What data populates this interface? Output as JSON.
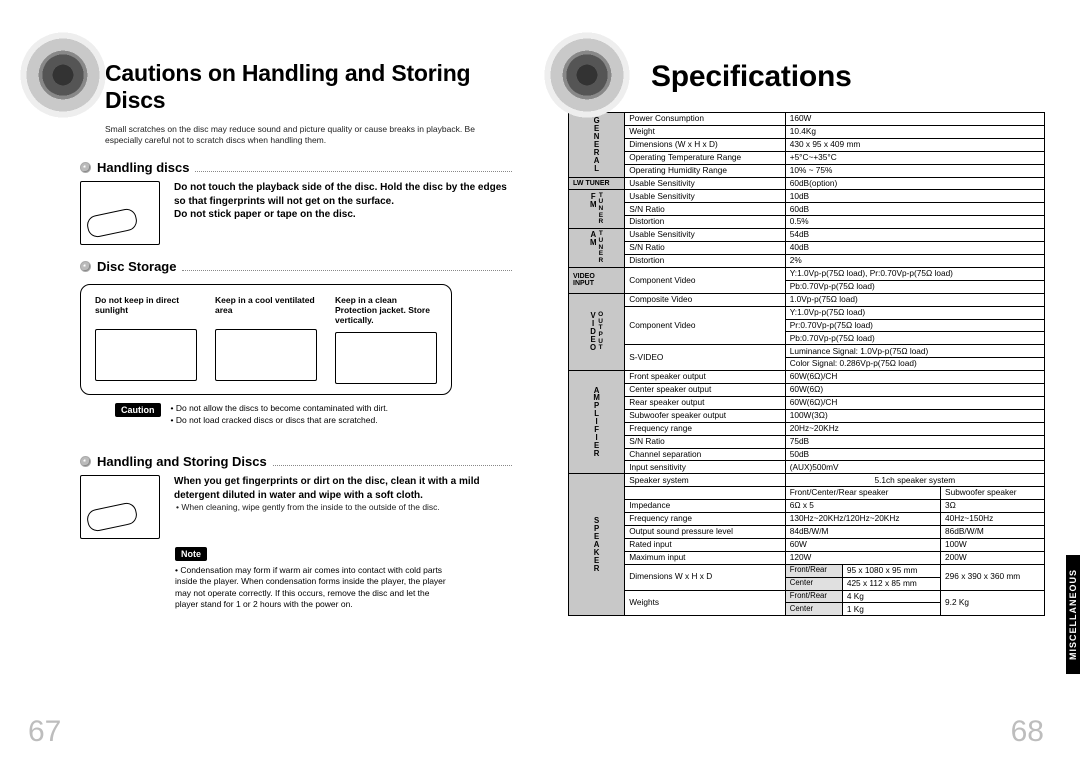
{
  "left": {
    "title": "Cautions on Handling and Storing Discs",
    "intro": "Small scratches on the disc may reduce sound and picture quality or cause breaks in playback. Be especially careful not to scratch discs when handling them.",
    "handling": {
      "head": "Handling discs",
      "p1": "Do not touch the playback side of the disc. Hold the disc by the edges so that fingerprints will not get on the surface.",
      "p2": "Do not stick paper or tape on the disc."
    },
    "storage": {
      "head": "Disc Storage",
      "cols": [
        "Do not keep in direct sunlight",
        "Keep in a cool ventilated area",
        "Keep in a clean Protection jacket. Store vertically."
      ]
    },
    "caution": {
      "tag": "Caution",
      "l1": "• Do not allow the discs to become contaminated with dirt.",
      "l2": "• Do not load cracked discs or discs that are scratched."
    },
    "handstore": {
      "head": "Handling and Storing Discs",
      "p1": "When you get fingerprints or dirt on the disc, clean it with a mild detergent diluted in water and wipe with a soft cloth.",
      "p2": "• When cleaning, wipe gently from the inside to the outside of the disc."
    },
    "note": {
      "tag": "Note",
      "text": "• Condensation may form if warm air comes into contact with cold parts inside the player. When condensation forms inside the player, the player may not operate correctly. If this occurs, remove the disc and let the player stand for 1 or 2 hours with the power on."
    },
    "pagenum": "67"
  },
  "right": {
    "title": "Specifications",
    "pagenum": "68",
    "side_tab": "MISCELLANEOUS",
    "specs": {
      "general": [
        {
          "l": "Power Consumption",
          "v": "160W"
        },
        {
          "l": "Weight",
          "v": "10.4Kg"
        },
        {
          "l": "Dimensions (W x H x D)",
          "v": "430 x 95 x 409 mm"
        },
        {
          "l": "Operating Temperature Range",
          "v": "+5°C~+35°C"
        },
        {
          "l": "Operating Humidity Range",
          "v": "10% ~ 75%"
        }
      ],
      "lwtuner": {
        "l": "Usable Sensitivity",
        "v": "60dB(option)"
      },
      "fm": [
        {
          "l": "Usable Sensitivity",
          "v": "10dB"
        },
        {
          "l": "S/N Ratio",
          "v": "60dB"
        },
        {
          "l": "Distortion",
          "v": "0.5%"
        }
      ],
      "am": [
        {
          "l": "Usable Sensitivity",
          "v": "54dB"
        },
        {
          "l": "S/N Ratio",
          "v": "40dB"
        },
        {
          "l": "Distortion",
          "v": "2%"
        }
      ],
      "video_input": {
        "l": "Component Video",
        "v1": "Y:1.0Vp-p(75Ω load), Pr:0.70Vp-p(75Ω load)",
        "v2": "Pb:0.70Vp-p(75Ω load)"
      },
      "video_out": [
        {
          "l": "Composite Video",
          "v": "1.0Vp-p(75Ω load)"
        },
        {
          "l": "Component Video",
          "v1": "Y:1.0Vp-p(75Ω load)",
          "v2": "Pr:0.70Vp-p(75Ω load)",
          "v3": "Pb:0.70Vp-p(75Ω load)"
        },
        {
          "l": "S-VIDEO",
          "v1": "Luminance Signal: 1.0Vp-p(75Ω load)",
          "v2": "Color Signal: 0.286Vp-p(75Ω load)"
        }
      ],
      "amplifier": [
        {
          "l": "Front speaker output",
          "v": "60W(6Ω)/CH"
        },
        {
          "l": "Center speaker output",
          "v": "60W(6Ω)"
        },
        {
          "l": "Rear speaker output",
          "v": "60W(6Ω)/CH"
        },
        {
          "l": "Subwoofer speaker output",
          "v": "100W(3Ω)"
        },
        {
          "l": "Frequency range",
          "v": "20Hz~20KHz"
        },
        {
          "l": "S/N Ratio",
          "v": "75dB"
        },
        {
          "l": "Channel separation",
          "v": "50dB"
        },
        {
          "l": "Input sensitivity",
          "v": "(AUX)500mV"
        }
      ],
      "speaker": {
        "system_l": "Speaker system",
        "system_v": "5.1ch speaker system",
        "h1": "Front/Center/Rear speaker",
        "h2": "Subwoofer speaker",
        "rows": [
          {
            "l": "Impedance",
            "c1": "6Ω x 5",
            "c2": "3Ω"
          },
          {
            "l": "Frequency range",
            "c1": "130Hz~20KHz/120Hz~20KHz",
            "c2": "40Hz~150Hz"
          },
          {
            "l": "Output sound pressure level",
            "c1": "84dB/W/M",
            "c2": "86dB/W/M"
          },
          {
            "l": "Rated input",
            "c1": "60W",
            "c2": "100W"
          },
          {
            "l": "Maximum input",
            "c1": "120W",
            "c2": "200W"
          }
        ],
        "dims": {
          "l": "Dimensions  W x H x D",
          "fr_l": "Front/Rear",
          "fr": "95 x 1080 x 95 mm",
          "ct_l": "Center",
          "ct": "425 x 112 x 85 mm",
          "sub": "296 x 390 x 360 mm"
        },
        "weights": {
          "l": "Weights",
          "fr_l": "Front/Rear",
          "fr": "4 Kg",
          "ct_l": "Center",
          "ct": "1 Kg",
          "sub": "9.2 Kg"
        }
      }
    }
  }
}
